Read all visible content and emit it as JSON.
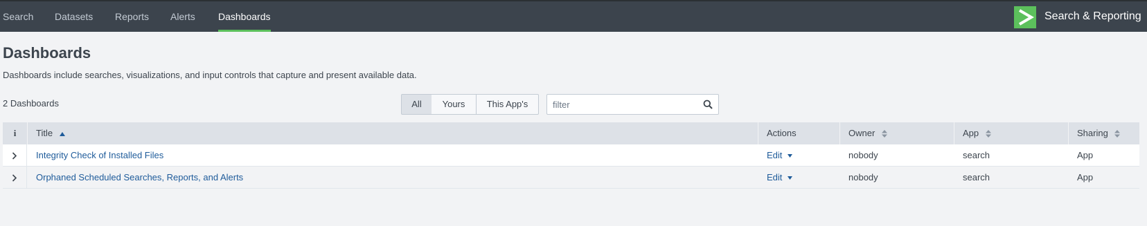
{
  "nav": {
    "items": [
      {
        "label": "Search",
        "active": false
      },
      {
        "label": "Datasets",
        "active": false
      },
      {
        "label": "Reports",
        "active": false
      },
      {
        "label": "Alerts",
        "active": false
      },
      {
        "label": "Dashboards",
        "active": true
      }
    ],
    "app_name": "Search & Reporting"
  },
  "page": {
    "title": "Dashboards",
    "description": "Dashboards include searches, visualizations, and input controls that capture and present available data.",
    "count_label": "2 Dashboards"
  },
  "filter_tabs": [
    {
      "label": "All",
      "active": true
    },
    {
      "label": "Yours",
      "active": false
    },
    {
      "label": "This App's",
      "active": false
    }
  ],
  "search": {
    "placeholder": "filter",
    "value": ""
  },
  "table": {
    "info_header": "i",
    "columns": [
      "Title",
      "Actions",
      "Owner",
      "App",
      "Sharing"
    ],
    "rows": [
      {
        "title": "Integrity Check of Installed Files",
        "action": "Edit",
        "owner": "nobody",
        "app": "search",
        "sharing": "App"
      },
      {
        "title": "Orphaned Scheduled Searches, Reports, and Alerts",
        "action": "Edit",
        "owner": "nobody",
        "app": "search",
        "sharing": "App"
      }
    ]
  },
  "colors": {
    "topbar": "#3c444d",
    "accent": "#5cc05c",
    "link": "#1e5b9a",
    "header_bg": "#dde1e7"
  },
  "icons": {
    "logo": "chevron-right-logo-icon",
    "search": "magnifier-icon",
    "expand": "chevron-right-icon",
    "sort_asc": "caret-up-icon",
    "sort": "sort-arrows-icon",
    "dropdown": "caret-down-icon"
  }
}
